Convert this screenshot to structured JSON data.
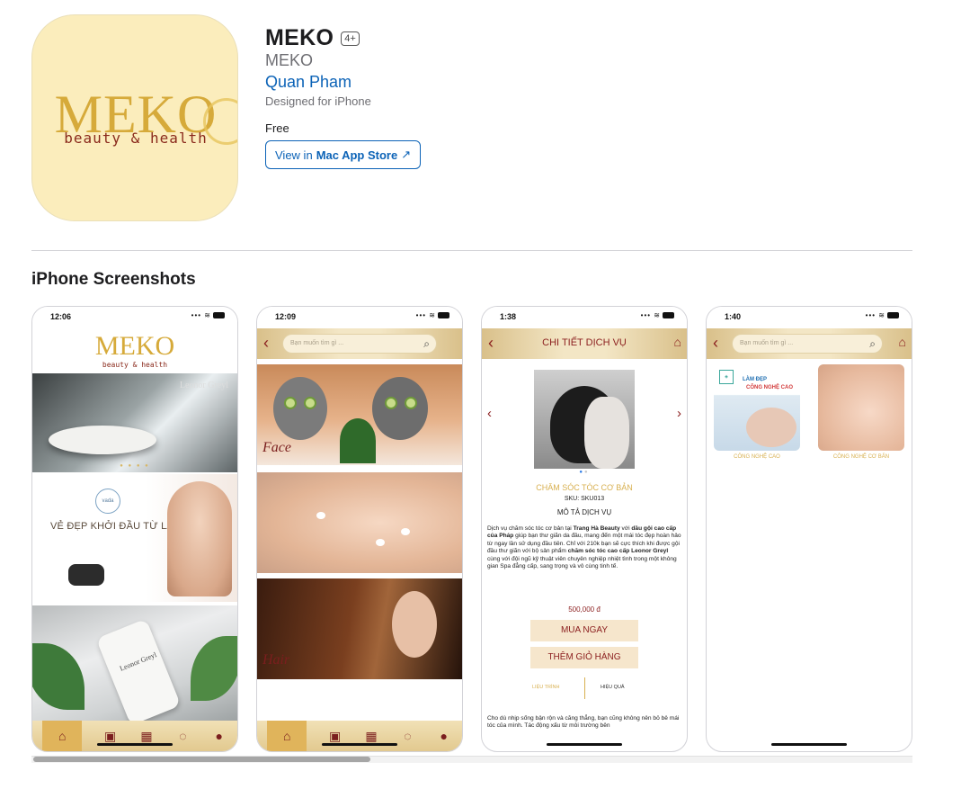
{
  "app": {
    "title": "MEKO",
    "age_rating": "4+",
    "subtitle": "MEKO",
    "developer": "Quan Pham",
    "designed_for": "Designed for iPhone",
    "price": "Free",
    "store_button_prefix": "View in ",
    "store_button_bold": "Mac App Store",
    "store_button_arrow": "↗",
    "icon": {
      "logo_word": "MEKO",
      "logo_tagline": "beauty & health",
      "background": "#fbedbc",
      "gold": "#d6aa3a",
      "maroon": "#8a2a1c"
    }
  },
  "section": {
    "title": "iPhone Screenshots"
  },
  "screenshots": [
    {
      "time": "12:06",
      "logo_word": "MEKO",
      "logo_tagline": "beauty & health",
      "banner_brand": "Leonor Greyl",
      "banner_headline": "VẺ ĐẸP KHỞI ĐẦU TỪ LÀN DA",
      "banner_logo": "vada",
      "bottle_label": "Leonor Greyl",
      "tabs": [
        "home-icon",
        "bag-icon",
        "calendar-icon",
        "chat-icon",
        "profile-icon"
      ]
    },
    {
      "time": "12:09",
      "search_placeholder": "Bạn muốn tìm gì ...",
      "categories": [
        "Face",
        "Hair"
      ]
    },
    {
      "time": "1:38",
      "header_title": "CHI TIẾT DỊCH VỤ",
      "service_name": "CHĂM SÓC TÓC CƠ BẢN",
      "sku": "SKU: SKU013",
      "description_heading": "MÔ TẢ DỊCH VỤ",
      "description": {
        "p1": "Dịch vụ chăm sóc tóc cơ bản tại ",
        "b1": "Trang Hà Beauty",
        "p2": " với ",
        "b2": "dầu gội cao cấp của Pháp",
        "p3": " giúp bạn thư giãn da đầu, mang đến một mái tóc đẹp hoàn hảo từ ngay lần sử dụng đầu tiên. Chỉ với 210k bạn sẽ cực thích khi được gội đầu thư giãn với bộ sản phẩm ",
        "b3": "chăm sóc tóc cao cấp Leonor Greyl",
        "p4": " cùng với đội ngũ kỹ thuật viên chuyên nghiệp nhiệt tình trong một không gian Spa đẳng cấp, sang trọng và vô cùng tinh tế."
      },
      "price": "500,000 đ",
      "buy_label": "MUA NGAY",
      "cart_label": "THÊM GIỎ HÀNG",
      "tab_left": "LIỆU TRÌNH",
      "tab_right": "HIỆU QUẢ",
      "footer_text": "Cho dù nhịp sống bận rộn và căng thẳng, bạn cũng không nên bỏ bê mái tóc của mình. Tác động xấu từ môi trường bên"
    },
    {
      "time": "1:40",
      "search_placeholder": "Bạn muốn tìm gì ...",
      "tile1_line1": "LÀM ĐẸP",
      "tile1_line2": "CÔNG NGHỆ CAO",
      "tile_captions": [
        "CÔNG NGHỆ CAO",
        "CÔNG NGHỆ CƠ BẢN"
      ]
    }
  ]
}
